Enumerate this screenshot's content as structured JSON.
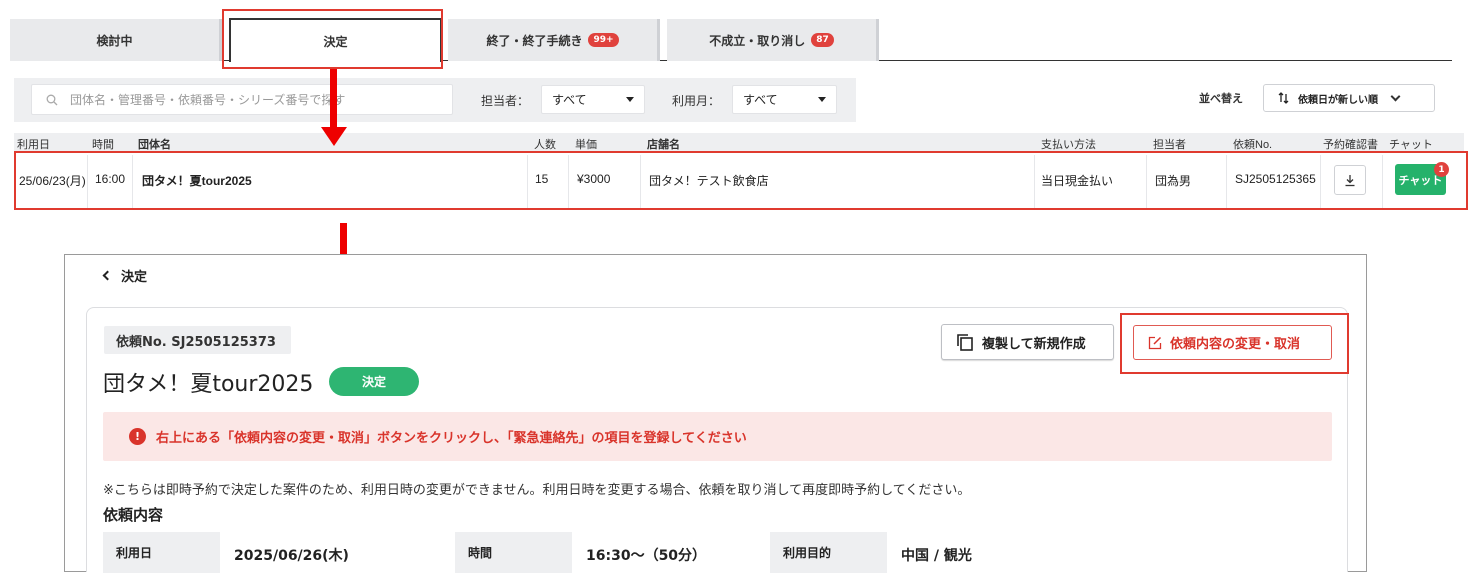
{
  "tabs": [
    {
      "label": "検討中",
      "badge": ""
    },
    {
      "label": "決定",
      "badge": ""
    },
    {
      "label": "終了・終了手続き",
      "badge": "99+"
    },
    {
      "label": "不成立・取り消し",
      "badge": "87"
    }
  ],
  "filters": {
    "search_placeholder": "団体名・管理番号・依頼番号・シリーズ番号で探す",
    "assignee_label": "担当者：",
    "assignee_value": "すべて",
    "month_label": "利用月：",
    "month_value": "すべて"
  },
  "sort": {
    "label": "並べ替え",
    "value": "依頼日が新しい順"
  },
  "table": {
    "headers": [
      "利用日",
      "時間",
      "団体名",
      "人数",
      "単価",
      "店舗名",
      "支払い方法",
      "担当者",
      "依頼No.",
      "予約確認書",
      "チャット"
    ],
    "row": {
      "date": "25/06/23(月)",
      "time": "16:00",
      "group": "団タメ！夏tour2025",
      "people": "15",
      "price": "¥3000",
      "store": "団タメ！テスト飲食店",
      "payment": "当日現金払い",
      "assignee": "団為男",
      "request_no": "SJ2505125365",
      "chat_label": "チャット",
      "chat_badge": "1"
    }
  },
  "detail": {
    "back_label": "決定",
    "request_no": "依頼No. SJ2505125373",
    "title": "団タメ！夏tour2025",
    "status": "決定",
    "duplicate_label": "複製して新規作成",
    "edit_label": "依頼内容の変更・取消",
    "alert": "右上にある「依頼内容の変更・取消」ボタンをクリックし、「緊急連絡先」の項目を登録してください",
    "note": "※こちらは即時予約で決定した案件のため、利用日時の変更ができません。利用日時を変更する場合、依頼を取り消して再度即時予約してください。",
    "section_title": "依頼内容",
    "info": [
      {
        "label": "利用日",
        "value": "2025/06/26(木)"
      },
      {
        "label": "時間",
        "value": "16:30〜（50分）"
      },
      {
        "label": "利用目的",
        "value": "中国 / 観光"
      }
    ]
  },
  "colors": {
    "accent_green": "#2eb572",
    "alert_red": "#d9342b",
    "annotation_red": "#ee0000"
  }
}
